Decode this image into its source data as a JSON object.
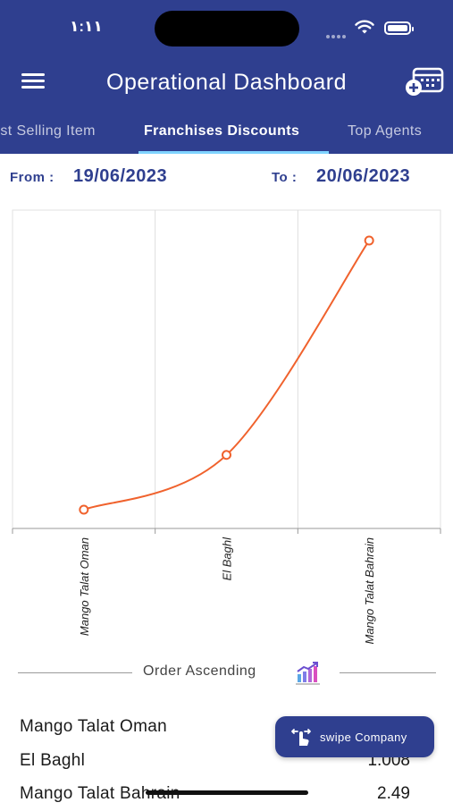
{
  "status_bar": {
    "time": "١:١١"
  },
  "header": {
    "title": "Operational Dashboard"
  },
  "tabs": [
    {
      "label": "Best Selling Item",
      "active": false
    },
    {
      "label": "Franchises Discounts",
      "active": true
    },
    {
      "label": "Top Agents",
      "active": false
    }
  ],
  "filters": {
    "from_label": "From :",
    "from_value": "19/06/2023",
    "to_label": "To :",
    "to_value": "20/06/2023"
  },
  "chart_data": {
    "type": "line",
    "categories": [
      "Mango Talat Oman",
      "El Baghl",
      "Mango Talat Bahrain"
    ],
    "series": [
      {
        "values": [
          0.63,
          1.008,
          2.49
        ]
      }
    ],
    "ylim": [
      0.5,
      2.7
    ],
    "grid": true,
    "line_color": "#f0622d",
    "xlabel": "",
    "ylabel": ""
  },
  "order": {
    "label": "Order Ascending",
    "icon": "chart-trend-icon"
  },
  "list": [
    {
      "name": "Mango Talat Oman",
      "value": ""
    },
    {
      "name": "El Baghl",
      "value": "1.008"
    },
    {
      "name": "Mango Talat Bahrain",
      "value": "2.49"
    }
  ],
  "swipe_button": {
    "label": "swipe Company",
    "icon": "swipe-hand-icon"
  },
  "colors": {
    "primary": "#2f3f8f",
    "accent": "#f0622d",
    "tab_indicator": "#7fd3ff"
  }
}
